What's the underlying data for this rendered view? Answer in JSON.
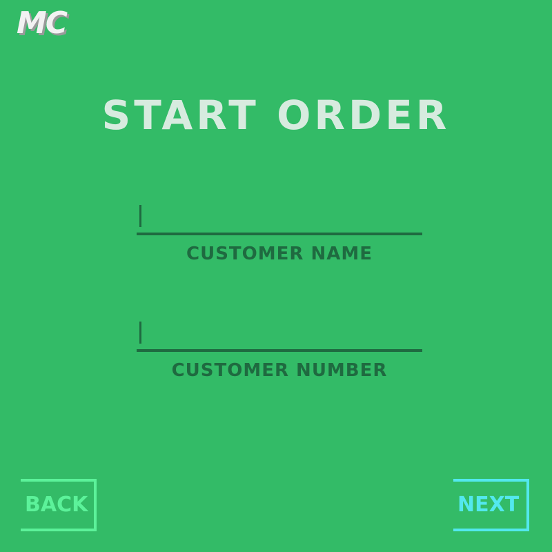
{
  "app": {
    "logo_text": "MC",
    "title": "START ORDER"
  },
  "form": {
    "fields": [
      {
        "label": "CUSTOMER NAME",
        "value": ""
      },
      {
        "label": "CUSTOMER NUMBER",
        "value": ""
      }
    ]
  },
  "nav": {
    "back_label": "BACK",
    "next_label": "NEXT"
  },
  "colors": {
    "background": "#33bb67",
    "title": "#d7ebdf",
    "field_text": "#1f6a40",
    "back_accent": "#5cf29a",
    "next_accent": "#53e8ee"
  }
}
